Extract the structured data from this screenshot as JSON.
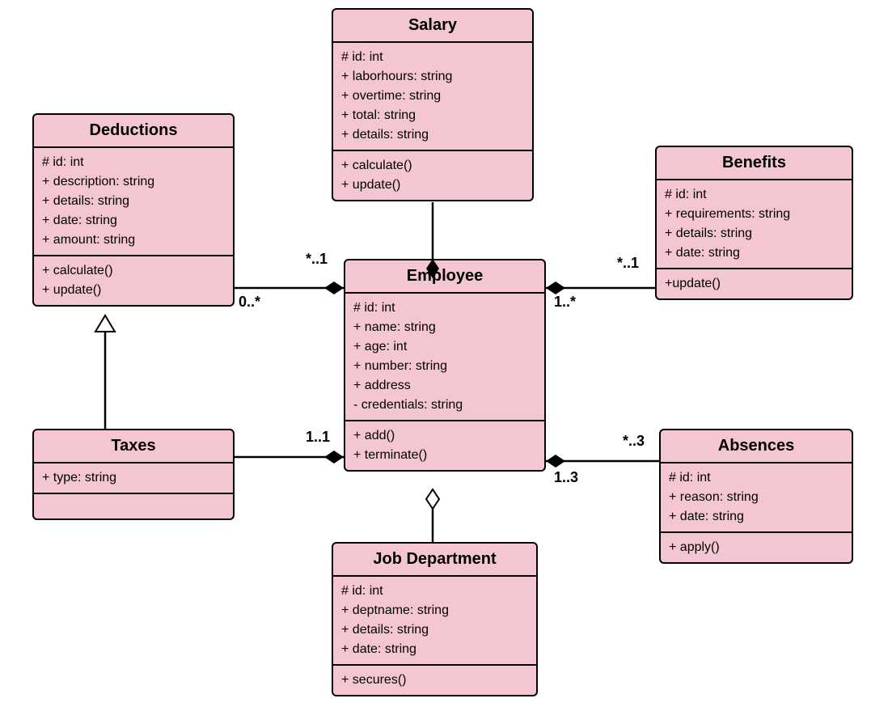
{
  "classes": {
    "salary": {
      "title": "Salary",
      "attrs": [
        "# id: int",
        "+ laborhours: string",
        "+ overtime: string",
        "+ total: string",
        "+ details: string"
      ],
      "ops": [
        "+ calculate()",
        "+ update()"
      ]
    },
    "deductions": {
      "title": "Deductions",
      "attrs": [
        "# id: int",
        "+ description: string",
        "+ details: string",
        "+ date: string",
        "+ amount: string"
      ],
      "ops": [
        "+ calculate()",
        "+ update()"
      ]
    },
    "benefits": {
      "title": "Benefits",
      "attrs": [
        "# id: int",
        "+ requirements: string",
        "+ details: string",
        "+ date: string"
      ],
      "ops": [
        "+update()"
      ]
    },
    "employee": {
      "title": "Employee",
      "attrs": [
        "# id: int",
        "+ name: string",
        "+ age: int",
        "+ number: string",
        "+ address",
        "- credentials: string"
      ],
      "ops": [
        "+ add()",
        "+ terminate()"
      ]
    },
    "taxes": {
      "title": "Taxes",
      "attrs": [
        "+ type: string"
      ],
      "ops": []
    },
    "absences": {
      "title": "Absences",
      "attrs": [
        "# id: int",
        "+ reason: string",
        "+ date: string"
      ],
      "ops": [
        "+ apply()"
      ]
    },
    "jobdept": {
      "title": "Job Department",
      "attrs": [
        "# id: int",
        "+ deptname: string",
        "+ details: string",
        "+ date: string"
      ],
      "ops": [
        "+ secures()"
      ]
    }
  },
  "multiplicities": {
    "ded_emp_near": "0..*",
    "ded_emp_far": "*..1",
    "ben_emp_near": "1..*",
    "ben_emp_far": "*..1",
    "tax_emp_far": "1..1",
    "abs_emp_near": "1..3",
    "abs_emp_far": "*..3"
  },
  "relationships": [
    {
      "from": "Salary",
      "to": "Employee",
      "type": "composition",
      "from_mult": null,
      "to_mult": null
    },
    {
      "from": "Deductions",
      "to": "Employee",
      "type": "composition",
      "from_mult": "0..*",
      "to_mult": "*..1"
    },
    {
      "from": "Benefits",
      "to": "Employee",
      "type": "composition",
      "from_mult": "*..1",
      "to_mult": "1..*"
    },
    {
      "from": "Taxes",
      "to": "Employee",
      "type": "composition",
      "from_mult": null,
      "to_mult": "1..1"
    },
    {
      "from": "Absences",
      "to": "Employee",
      "type": "composition",
      "from_mult": "*..3",
      "to_mult": "1..3"
    },
    {
      "from": "Job Department",
      "to": "Employee",
      "type": "aggregation",
      "from_mult": null,
      "to_mult": null
    },
    {
      "from": "Taxes",
      "to": "Deductions",
      "type": "inheritance",
      "from_mult": null,
      "to_mult": null
    }
  ]
}
